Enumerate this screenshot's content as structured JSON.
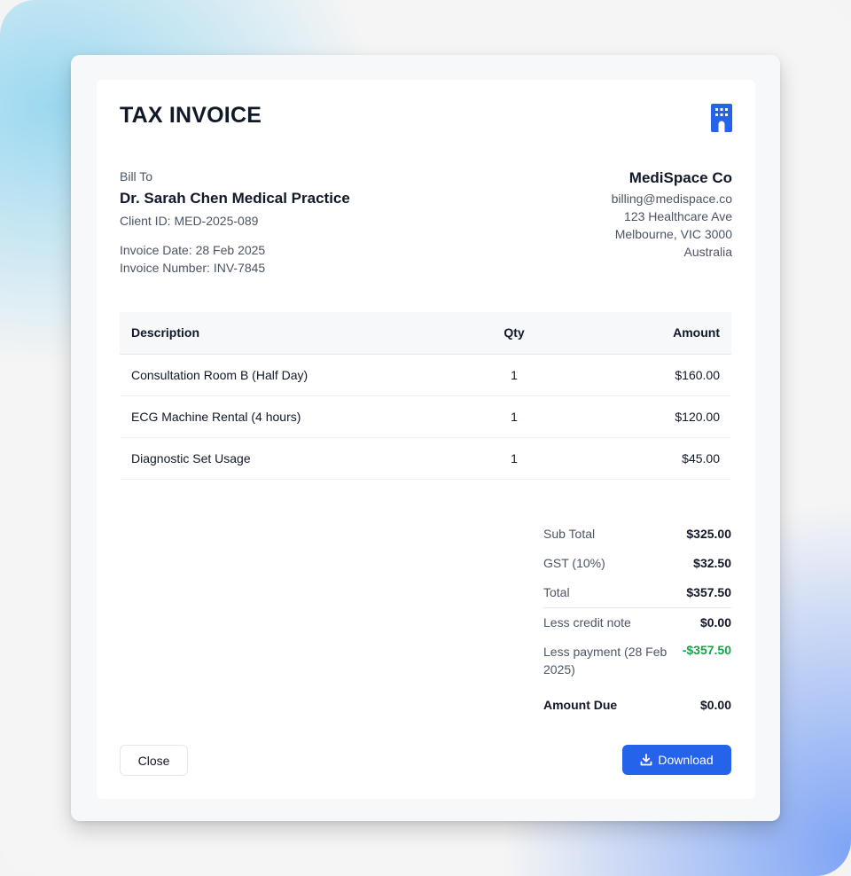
{
  "header": {
    "title": "TAX INVOICE",
    "icon": "building-icon"
  },
  "bill_to": {
    "label": "Bill To",
    "client_name": "Dr. Sarah Chen Medical Practice",
    "client_id": "Client ID: MED-2025-089",
    "invoice_date": "Invoice Date: 28 Feb 2025",
    "invoice_number": "Invoice Number: INV-7845"
  },
  "company": {
    "name": "MediSpace Co",
    "email": "billing@medispace.co",
    "address_line1": "123 Healthcare Ave",
    "address_line2": "Melbourne, VIC 3000",
    "country": "Australia"
  },
  "table": {
    "headers": {
      "description": "Description",
      "qty": "Qty",
      "amount": "Amount"
    },
    "rows": [
      {
        "description": "Consultation Room B (Half Day)",
        "qty": "1",
        "amount": "$160.00"
      },
      {
        "description": "ECG Machine Rental (4 hours)",
        "qty": "1",
        "amount": "$120.00"
      },
      {
        "description": "Diagnostic Set Usage",
        "qty": "1",
        "amount": "$45.00"
      }
    ]
  },
  "totals": {
    "subtotal": {
      "label": "Sub Total",
      "value": "$325.00"
    },
    "gst": {
      "label": "GST (10%)",
      "value": "$32.50"
    },
    "total": {
      "label": "Total",
      "value": "$357.50"
    },
    "credit_note": {
      "label": "Less credit note",
      "value": "$0.00"
    },
    "payment": {
      "label": "Less payment (28 Feb 2025)",
      "value": "-$357.50"
    },
    "amount_due": {
      "label": "Amount Due",
      "value": "$0.00"
    }
  },
  "actions": {
    "close_label": "Close",
    "download_label": "Download",
    "download_icon": "download-icon"
  },
  "colors": {
    "accent": "#2563eb",
    "negative": "#16a34a",
    "title": "#111827"
  }
}
